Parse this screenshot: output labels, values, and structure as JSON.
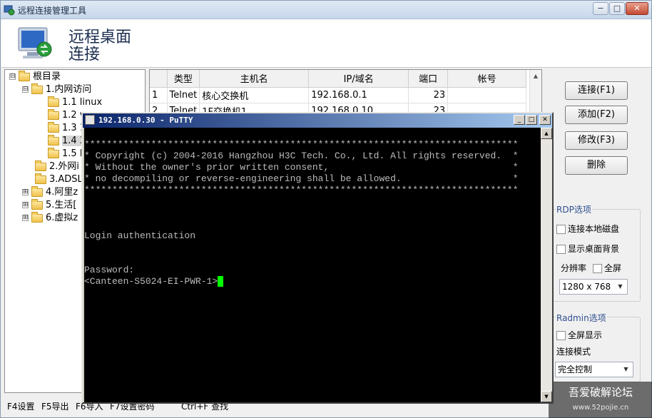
{
  "window": {
    "title": "远程连接管理工具",
    "controls": {
      "minimize": "−",
      "maximize": "□",
      "close": "✕"
    }
  },
  "banner": {
    "line1": "远程桌面",
    "line2": "连接",
    "icon": "remote-desktop-monitor-icon"
  },
  "tree": {
    "items": [
      {
        "label": "根目录",
        "expander": "⊟",
        "level": 0
      },
      {
        "label": "1.内网访问",
        "expander": "⊟",
        "level": 1
      },
      {
        "label": "1.1 linux",
        "expander": "",
        "level": 2
      },
      {
        "label": "1.2 v",
        "expander": "",
        "level": 2
      },
      {
        "label": "1.3 1",
        "expander": "",
        "level": 2
      },
      {
        "label": "1.4 3",
        "expander": "",
        "level": 2,
        "selected": true
      },
      {
        "label": "1.5 F",
        "expander": "",
        "level": 2
      },
      {
        "label": "2.外网i",
        "expander": "",
        "level": 1
      },
      {
        "label": "3.ADSL[",
        "expander": "",
        "level": 1
      },
      {
        "label": "4.阿里z",
        "expander": "⊞",
        "level": 1
      },
      {
        "label": "5.生活[",
        "expander": "⊞",
        "level": 1
      },
      {
        "label": "6.虚拟z",
        "expander": "⊞",
        "level": 1
      }
    ]
  },
  "table": {
    "headers": [
      "",
      "类型",
      "主机名",
      "IP/域名",
      "端口",
      "帐号"
    ],
    "rows": [
      [
        "1",
        "Telnet",
        "核心交换机",
        "192.168.0.1",
        "23",
        ""
      ],
      [
        "2",
        "Telnet",
        "1F交换机1",
        "192.168.0.10",
        "23",
        ""
      ]
    ]
  },
  "buttons": {
    "connect": "连接(F1)",
    "add": "添加(F2)",
    "edit": "修改(F3)",
    "delete": "删除"
  },
  "rdp": {
    "group_label": "RDP选项",
    "local_disk": "连接本地磁盘",
    "desktop_bg": "显示桌面背景",
    "resolution_label": "分辨率",
    "fullscreen": "全屏",
    "resolution_value": "1280 x 768"
  },
  "radmin": {
    "group_label": "Radmin选项",
    "fullscreen_display": "全屏显示",
    "mode_label": "连接模式",
    "mode_value": "完全控制"
  },
  "statusbar": {
    "f4": "F4设置",
    "f5": "F5导出",
    "f6": "F6导入",
    "f7": "F7设置密码",
    "ctrlf": "Ctrl+F 查找"
  },
  "watermark": {
    "line1": "吾爱破解论坛",
    "line2": "www.52pojie.cn"
  },
  "putty": {
    "title": "192.168.0.30 - PuTTY",
    "controls": {
      "minimize": "_",
      "maximize": "□",
      "close": "✕"
    },
    "terminal_lines": [
      "******************************************************************************",
      "* Copyright (c) 2004-2016 Hangzhou H3C Tech. Co., Ltd. All rights reserved.  *",
      "* Without the owner's prior written consent,                                 *",
      "* no decompiling or reverse-engineering shall be allowed.                    *",
      "******************************************************************************",
      "",
      "",
      "",
      "Login authentication",
      "",
      "",
      "Password:"
    ],
    "prompt": "<Canteen-S5024-EI-PWR-1>"
  }
}
